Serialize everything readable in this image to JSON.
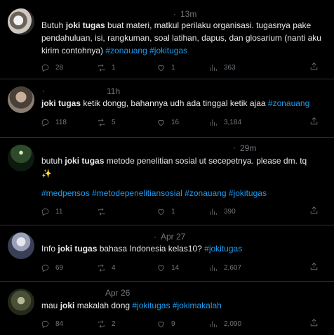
{
  "tweets": [
    {
      "name_mark": "·",
      "time": "13m",
      "text": {
        "p1": "Butuh ",
        "bold": "joki tugas",
        "p2": " buat materi, matkul perilaku organisasi. tugasnya pake pendahuluan, isi, rangkuman, soal latihan, dapus, dan glosarium (nanti aku kirim contohnya) ",
        "tag1": "#zonauang",
        "tag2": "#jokitugas"
      },
      "counts": {
        "replies": "28",
        "retweets": "1",
        "likes": "1",
        "views": "363"
      }
    },
    {
      "name_mark": "·",
      "time": "11h",
      "text": {
        "bold": "joki tugas",
        "p2": " ketik dongg, bahannya udh ada tinggal ketik ajaa ",
        "tag1": "#zonauang"
      },
      "counts": {
        "replies": "118",
        "retweets": "5",
        "likes": "16",
        "views": "3,184"
      }
    },
    {
      "name_mark": "·",
      "time": "29m",
      "text": {
        "p1": "butuh ",
        "bold": "joki tugas",
        "p2": " metode penelitian sosial ut secepetnya. please dm. tq ",
        "emoji": "✨",
        "tags": [
          "#medpensos",
          "#metodepenelitiansosial",
          "#zonauang",
          "#jokitugas"
        ]
      },
      "counts": {
        "replies": "11",
        "retweets": "",
        "likes": "1",
        "views": "390"
      }
    },
    {
      "name_mark": "·",
      "time": "Apr 27",
      "text": {
        "p1": "Info ",
        "bold": "joki tugas",
        "p2": " bahasa Indonesia kelas10? ",
        "tag1": "#jokitugas"
      },
      "counts": {
        "replies": "69",
        "retweets": "4",
        "likes": "14",
        "views": "2,607"
      }
    },
    {
      "name_mark": "",
      "time": "Apr 26",
      "text": {
        "p1": "mau ",
        "bold": "joki",
        "p2": " makalah dong ",
        "tag1": "#jokitugas",
        "tag2": "#jokimakalah"
      },
      "counts": {
        "replies": "84",
        "retweets": "2",
        "likes": "9",
        "views": "2,090"
      }
    }
  ],
  "icons": [
    "reply-icon",
    "retweet-icon",
    "like-icon",
    "views-icon",
    "share-icon"
  ],
  "colors": {
    "background": "#000000",
    "text": "#e7e9ea",
    "muted": "#71767b",
    "hashtag": "#1d9bf0",
    "divider": "#2f3336"
  }
}
